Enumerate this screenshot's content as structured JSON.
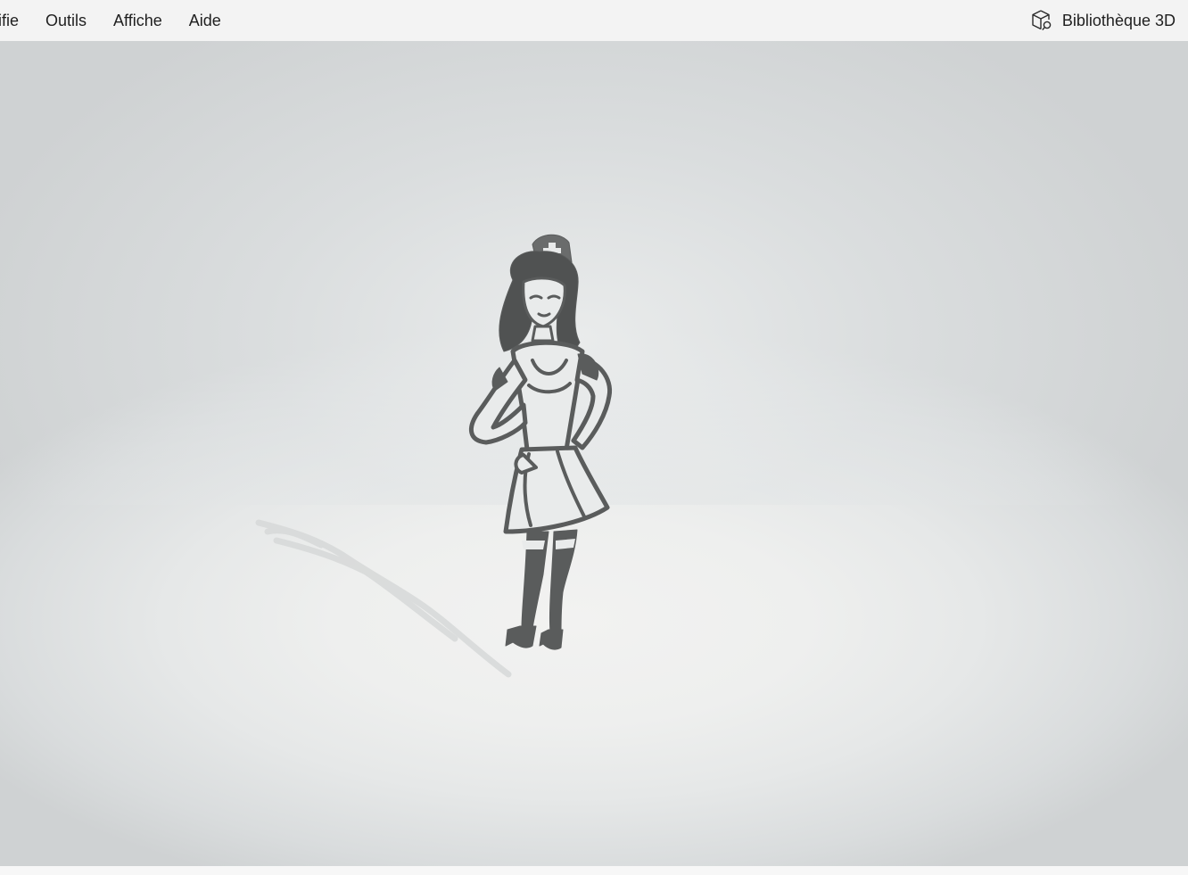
{
  "menubar": {
    "items": [
      {
        "label": "difie"
      },
      {
        "label": "Outils"
      },
      {
        "label": "Affiche"
      },
      {
        "label": "Aide"
      }
    ],
    "library_button": {
      "label": "Bibliothèque 3D",
      "icon": "cube-search-icon"
    }
  },
  "viewport": {
    "model_icon": "figure-model",
    "background_color": "#e6e8e8",
    "model_color": "#5a5c5c"
  }
}
